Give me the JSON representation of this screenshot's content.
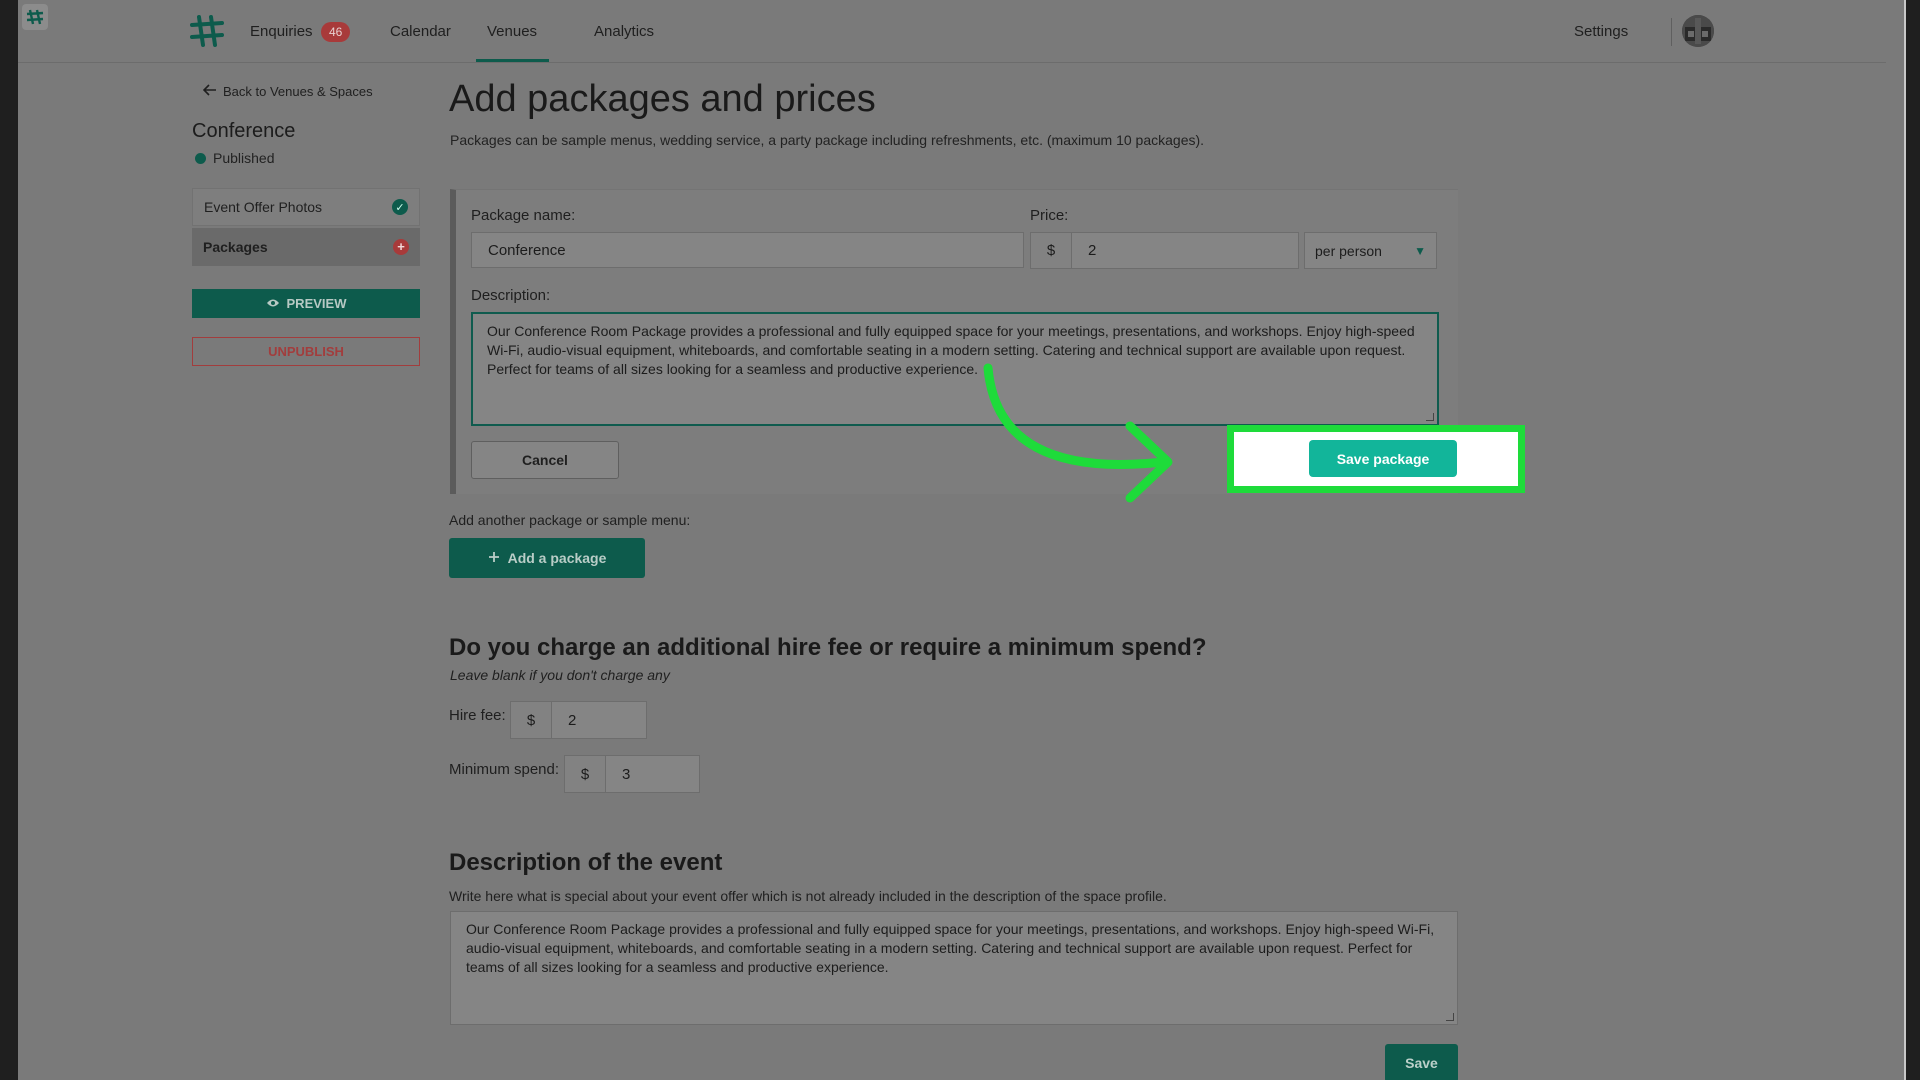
{
  "nav": {
    "enquiries": "Enquiries",
    "enquiries_count": "46",
    "calendar": "Calendar",
    "venues": "Venues",
    "analytics": "Analytics",
    "settings": "Settings"
  },
  "sidebar": {
    "back": "Back to Venues & Spaces",
    "venue_name": "Conference",
    "status": "Published",
    "items": [
      {
        "label": "Event Offer Photos",
        "state": "complete"
      },
      {
        "label": "Packages",
        "state": "incomplete"
      }
    ],
    "preview": "PREVIEW",
    "unpublish": "UNPUBLISH"
  },
  "page": {
    "title": "Add packages and prices",
    "subtitle": "Packages can be sample menus, wedding service, a party package including refreshments, etc. (maximum 10 packages)."
  },
  "package_form": {
    "name_label": "Package name:",
    "name_value": "Conference",
    "price_label": "Price:",
    "currency": "$",
    "price_value": "2",
    "unit_selected": "per person",
    "description_label": "Description:",
    "description_value": "Our Conference Room Package provides a professional and fully equipped space for your meetings, presentations, and workshops. Enjoy high-speed Wi-Fi, audio-visual equipment, whiteboards, and comfortable seating in a modern setting. Catering and technical support are available upon request. Perfect for teams of all sizes looking for a seamless and productive experience.",
    "cancel": "Cancel",
    "save": "Save package"
  },
  "add_package": {
    "label": "Add another package or sample menu:",
    "button": "Add a package"
  },
  "fees": {
    "heading": "Do you charge an additional hire fee or require a minimum spend?",
    "hint": "Leave blank if you don't charge any",
    "hire_label": "Hire fee:",
    "hire_currency": "$",
    "hire_value": "2",
    "min_label": "Minimum spend:",
    "min_currency": "$",
    "min_value": "3"
  },
  "event_description": {
    "heading": "Description of the event",
    "subtitle": "Write here what is special about your event offer which is not already included in the description of the space profile.",
    "value": "Our Conference Room Package provides a professional and fully equipped space for your meetings, presentations, and workshops. Enjoy high-speed Wi-Fi, audio-visual equipment, whiteboards, and comfortable seating in a modern setting. Catering and technical support are available upon request. Perfect for teams of all sizes looking for a seamless and productive experience.",
    "save": "Save"
  },
  "colors": {
    "brand": "#0d5b4c",
    "highlight": "#1edb3a",
    "save_package": "#12b59a",
    "danger": "#a83a3a"
  }
}
